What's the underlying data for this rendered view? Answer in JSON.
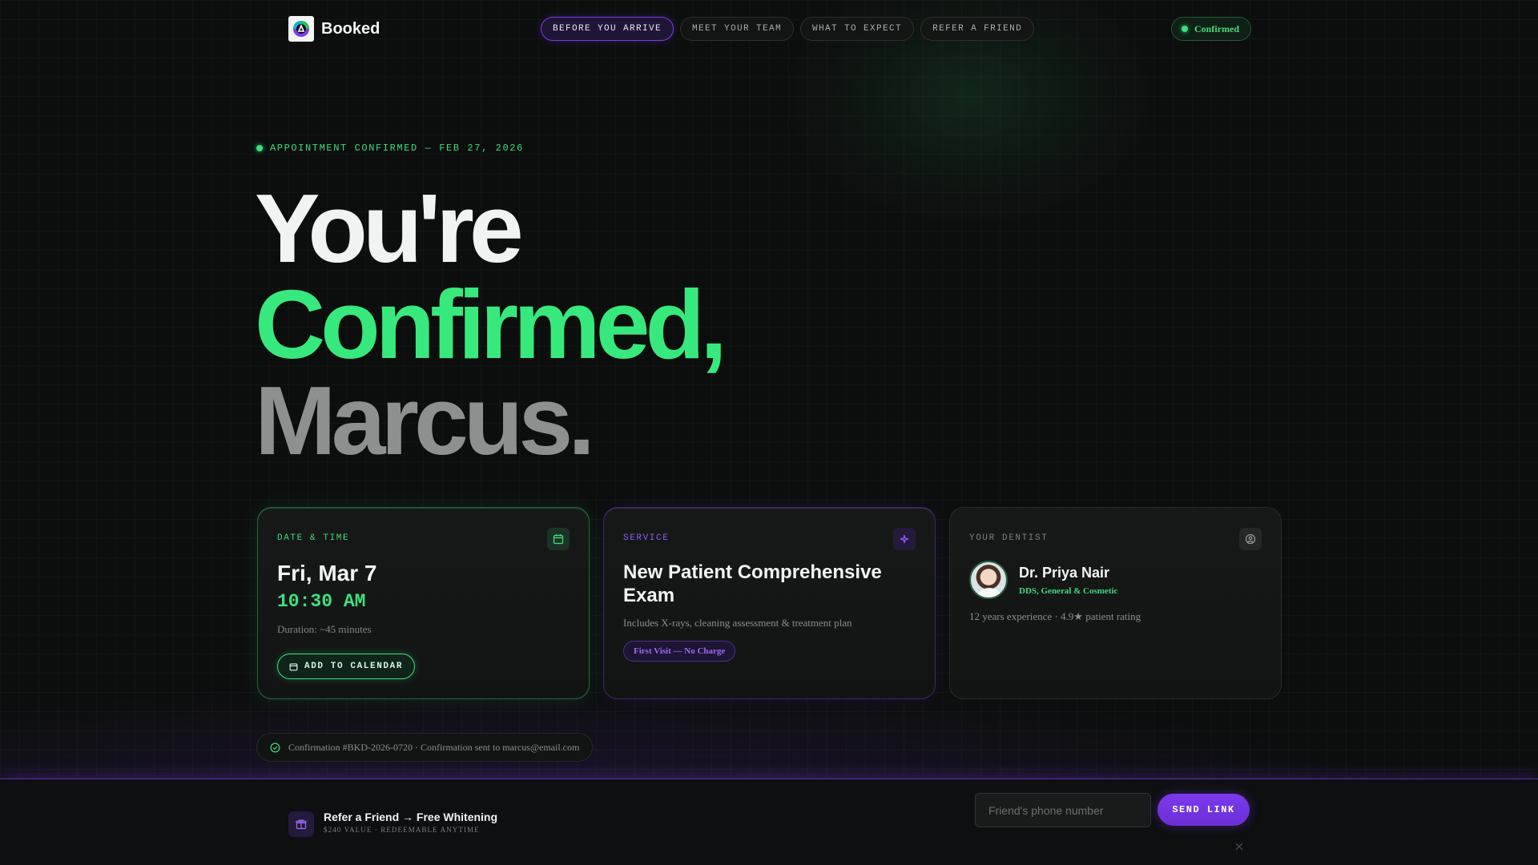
{
  "nav": {
    "brand": "Booked",
    "tabs": [
      {
        "label": "BEFORE YOU ARRIVE",
        "active": true
      },
      {
        "label": "MEET YOUR TEAM",
        "active": false
      },
      {
        "label": "WHAT TO EXPECT",
        "active": false
      },
      {
        "label": "REFER A FRIEND",
        "active": false
      }
    ],
    "status": "Confirmed"
  },
  "hero": {
    "eyebrow": "APPOINTMENT CONFIRMED — FEB 27, 2026",
    "line1": "You're",
    "line2": "Confirmed,",
    "line3": "Marcus."
  },
  "cards": {
    "datetime": {
      "label": "DATE & TIME",
      "date": "Fri, Mar 7",
      "time": "10:30 AM",
      "duration": "Duration: ~45 minutes",
      "button": "ADD TO CALENDAR"
    },
    "service": {
      "label": "SERVICE",
      "title": "New Patient Comprehensive Exam",
      "description": "Includes X-rays, cleaning assessment & treatment plan",
      "badge": "First Visit — No Charge"
    },
    "dentist": {
      "label": "YOUR DENTIST",
      "name": "Dr. Priya Nair",
      "role": "DDS, General & Cosmetic",
      "meta": "12 years experience · 4.9★ patient rating"
    }
  },
  "confirmation": "Confirmation #BKD-2026-0720 · Confirmation sent to marcus@email.com",
  "footer": {
    "title": "Refer a Friend → Free Whitening",
    "subtitle": "$240 VALUE · REDEEMABLE ANYTIME",
    "phone_placeholder": "Friend's phone number",
    "phone_value": "",
    "send_label": "SEND LINK"
  },
  "colors": {
    "accent_green": "#37e97c",
    "accent_purple": "#7c3aed",
    "background": "#0c0e0e"
  },
  "icons": [
    "logo-icon",
    "status-dot-icon",
    "calendar-icon",
    "sparkle-icon",
    "user-icon",
    "check-circle-icon",
    "gift-icon",
    "close-icon"
  ]
}
